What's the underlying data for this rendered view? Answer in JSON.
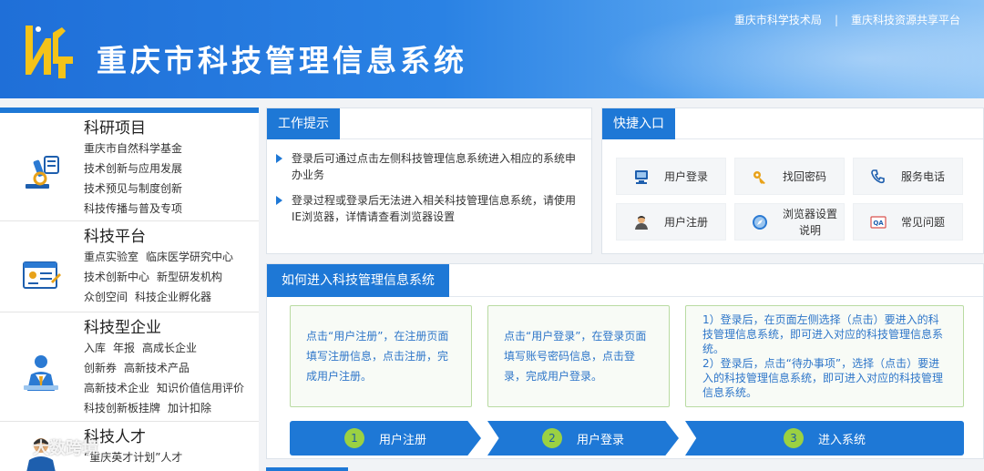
{
  "header": {
    "title": "重庆市科技管理信息系统",
    "links": [
      "重庆市科学技术局",
      "重庆科技资源共享平台"
    ],
    "separator": "|"
  },
  "sidebar": {
    "categories": [
      {
        "title": "科研项目",
        "icon": "microscope-icon",
        "lines": [
          [
            "重庆市自然科学基金"
          ],
          [
            "技术创新与应用发展"
          ],
          [
            "技术预见与制度创新"
          ],
          [
            "科技传播与普及专项"
          ]
        ]
      },
      {
        "title": "科技平台",
        "icon": "id-card-icon",
        "lines": [
          [
            "重点实验室",
            "临床医学研究中心"
          ],
          [
            "技术创新中心",
            "新型研发机构"
          ],
          [
            "众创空间",
            "科技企业孵化器"
          ]
        ]
      },
      {
        "title": "科技型企业",
        "icon": "enterprise-person-icon",
        "lines": [
          [
            "入库",
            "年报",
            "高成长企业"
          ],
          [
            "创新券",
            "高新技术产品"
          ],
          [
            "高新技术企业",
            "知识价值信用评价"
          ],
          [
            "科技创新板挂牌",
            "加计扣除"
          ]
        ]
      },
      {
        "title": "科技人才",
        "icon": "talent-person-icon",
        "lines": [
          [
            "“重庆英才计划”人才"
          ]
        ]
      }
    ]
  },
  "tips": {
    "title": "工作提示",
    "items": [
      "登录后可通过点击左侧科技管理信息系统进入相应的系统申办业务",
      "登录过程或登录后无法进入相关科技管理信息系统，请使用IE浏览器，详情请查看浏览器设置"
    ]
  },
  "quick": {
    "title": "快捷入口",
    "buttons": [
      {
        "label": "用户登录",
        "icon": "computer-icon"
      },
      {
        "label": "找回密码",
        "icon": "key-icon"
      },
      {
        "label": "服务电话",
        "icon": "phone-icon"
      },
      {
        "label": "用户注册",
        "icon": "user-icon"
      },
      {
        "label": "浏览器设置说明",
        "label_lines": [
          "浏览器设置",
          "说明"
        ],
        "icon": "compass-icon"
      },
      {
        "label": "常见问题",
        "icon": "qa-icon"
      }
    ]
  },
  "howto": {
    "title": "如何进入科技管理信息系统",
    "boxes": [
      "点击“用户注册”，在注册页面填写注册信息，点击注册，完成用户注册。",
      "点击“用户登录”，在登录页面填写账号密码信息，点击登录，完成用户登录。",
      "1）登录后，在页面左侧选择（点击）要进入的科技管理信息系统，即可进入对应的科技管理信息系统。\n2）登录后，点击“待办事项”，选择（点击）要进入的科技管理信息系统，即可进入对应的科技管理信息系统。"
    ],
    "steps": [
      {
        "num": "1",
        "label": "用户注册"
      },
      {
        "num": "2",
        "label": "用户登录"
      },
      {
        "num": "3",
        "label": "进入系统"
      }
    ]
  },
  "watermark": {
    "text": "大数跨境"
  },
  "colors": {
    "primary": "#1e78d6",
    "step_circle": "#9bd142",
    "step_border": "#b9dba2",
    "step_text": "#2e76c9"
  }
}
